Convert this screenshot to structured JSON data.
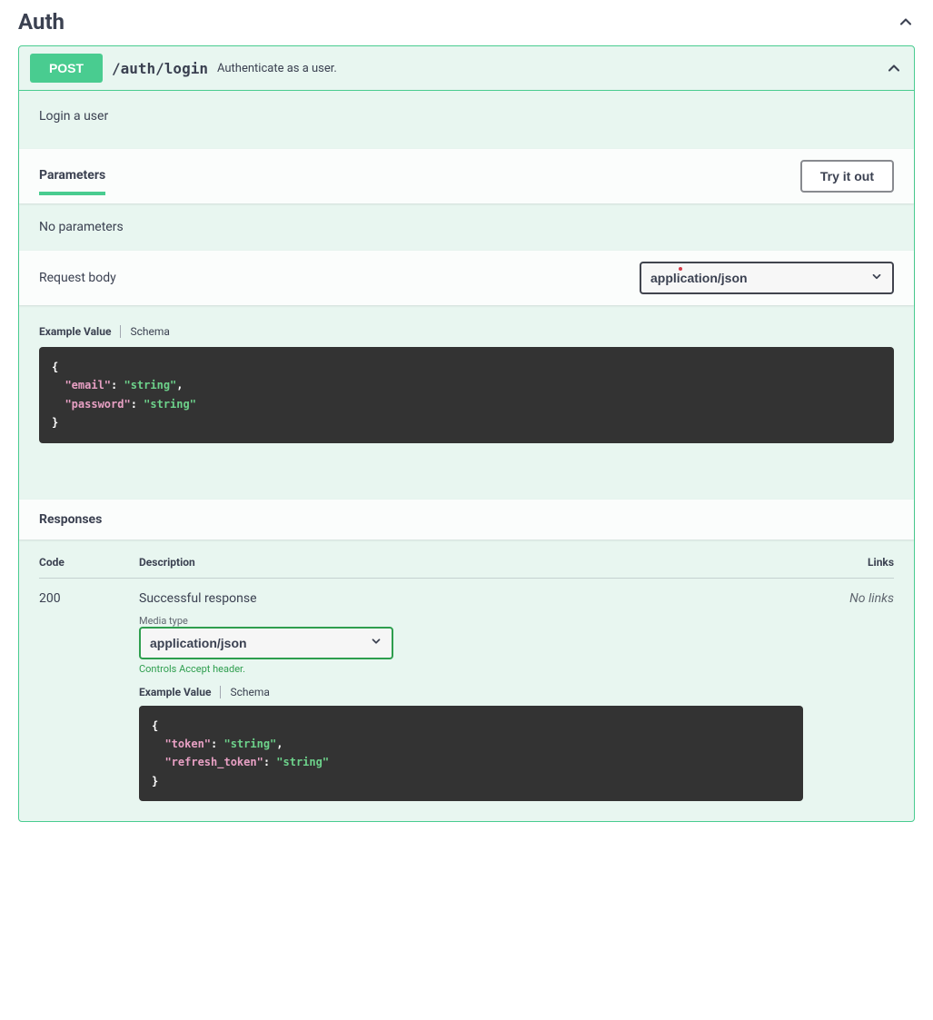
{
  "section": {
    "title": "Auth"
  },
  "operation": {
    "method": "POST",
    "path": "/auth/login",
    "summary": "Authenticate as a user.",
    "description": "Login a user"
  },
  "parameters": {
    "heading": "Parameters",
    "try_button": "Try it out",
    "empty": "No parameters"
  },
  "request_body": {
    "label": "Request body",
    "content_type": "application/json",
    "tab_example": "Example Value",
    "tab_schema": "Schema",
    "example": {
      "k1": "\"email\"",
      "v1": "\"string\"",
      "k2": "\"password\"",
      "v2": "\"string\""
    }
  },
  "responses": {
    "heading": "Responses",
    "col_code": "Code",
    "col_desc": "Description",
    "col_links": "Links",
    "row": {
      "code": "200",
      "desc": "Successful response",
      "media_label": "Media type",
      "media_type": "application/json",
      "accept_hint": "Controls Accept header.",
      "tab_example": "Example Value",
      "tab_schema": "Schema",
      "links": "No links",
      "example": {
        "k1": "\"token\"",
        "v1": "\"string\"",
        "k2": "\"refresh_token\"",
        "v2": "\"string\""
      }
    }
  }
}
